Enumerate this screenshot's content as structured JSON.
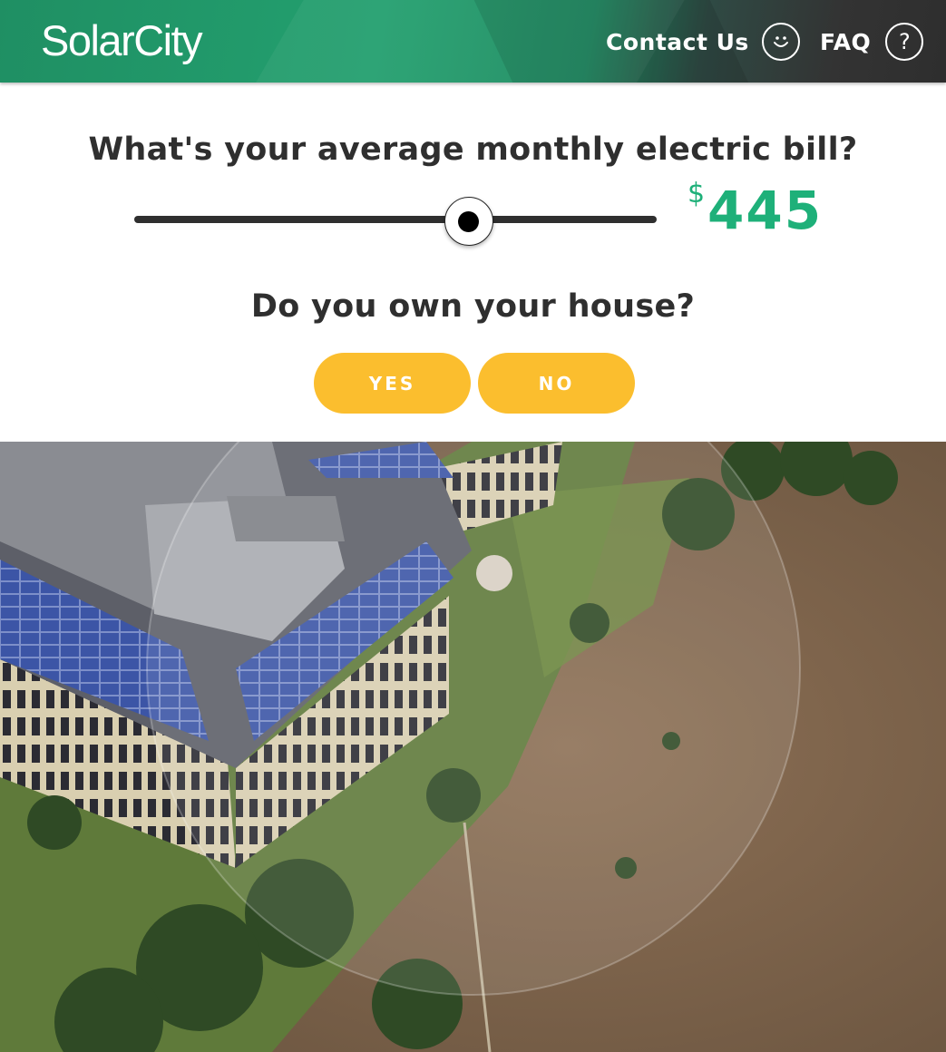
{
  "header": {
    "logo": "SolarCity",
    "contact_label": "Contact Us",
    "contact_icon": "smiley-icon",
    "faq_label": "FAQ",
    "faq_icon": "question-icon",
    "faq_glyph": "?"
  },
  "bill_question": {
    "label": "What's your average monthly electric bill?",
    "currency": "$",
    "amount": "445",
    "slider_fraction": 0.64
  },
  "ownership_question": {
    "label": "Do you own your house?",
    "yes_label": "YES",
    "no_label": "NO"
  },
  "colors": {
    "brand_green": "#1eb079",
    "button_yellow": "#fbbe2e",
    "text_dark": "#2f2f2f"
  }
}
